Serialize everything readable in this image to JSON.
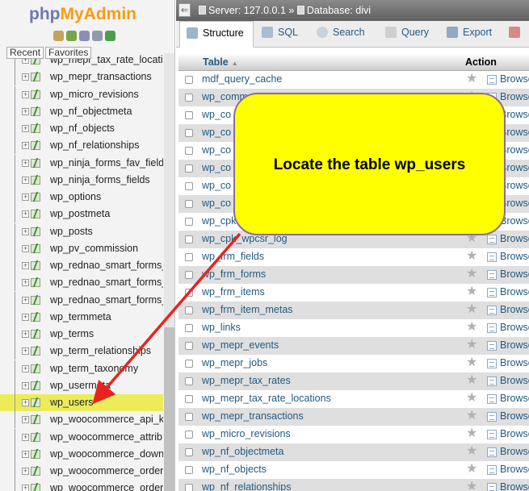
{
  "app": {
    "logo": {
      "php": "php",
      "my": "MyAdmin"
    },
    "logo_icons": [
      "home-icon",
      "exit-icon",
      "docs-icon",
      "settings-icon",
      "reload-icon"
    ]
  },
  "nav": {
    "tabs": [
      "Recent",
      "Favorites"
    ],
    "tree_items": [
      {
        "label": "wp_mepr_tax_rate_locati",
        "highlighted": false
      },
      {
        "label": "wp_mepr_transactions",
        "highlighted": false
      },
      {
        "label": "wp_micro_revisions",
        "highlighted": false
      },
      {
        "label": "wp_nf_objectmeta",
        "highlighted": false
      },
      {
        "label": "wp_nf_objects",
        "highlighted": false
      },
      {
        "label": "wp_nf_relationships",
        "highlighted": false
      },
      {
        "label": "wp_ninja_forms_fav_field",
        "highlighted": false
      },
      {
        "label": "wp_ninja_forms_fields",
        "highlighted": false
      },
      {
        "label": "wp_options",
        "highlighted": false
      },
      {
        "label": "wp_postmeta",
        "highlighted": false
      },
      {
        "label": "wp_posts",
        "highlighted": false
      },
      {
        "label": "wp_pv_commission",
        "highlighted": false
      },
      {
        "label": "wp_rednao_smart_forms_",
        "highlighted": false
      },
      {
        "label": "wp_rednao_smart_forms_",
        "highlighted": false
      },
      {
        "label": "wp_rednao_smart_forms_",
        "highlighted": false
      },
      {
        "label": "wp_termmeta",
        "highlighted": false
      },
      {
        "label": "wp_terms",
        "highlighted": false
      },
      {
        "label": "wp_term_relationships",
        "highlighted": false
      },
      {
        "label": "wp_term_taxonomy",
        "highlighted": false
      },
      {
        "label": "wp_usermeta",
        "highlighted": false
      },
      {
        "label": "wp_users",
        "highlighted": true
      },
      {
        "label": "wp_woocommerce_api_k",
        "highlighted": false
      },
      {
        "label": "wp_woocommerce_attrib",
        "highlighted": false
      },
      {
        "label": "wp_woocommerce_down",
        "highlighted": false
      },
      {
        "label": "wp_woocommerce_order",
        "highlighted": false
      },
      {
        "label": "wp_woocommerce_order",
        "highlighted": false
      }
    ]
  },
  "breadcrumb": {
    "server": "Server: 127.0.0.1",
    "separator": "»",
    "database": "Database: divi"
  },
  "tabs": [
    {
      "label": "Structure",
      "icon": "structure-icon",
      "active": true
    },
    {
      "label": "SQL",
      "icon": "sql-icon",
      "active": false
    },
    {
      "label": "Search",
      "icon": "search-icon",
      "active": false
    },
    {
      "label": "Query",
      "icon": "query-icon",
      "active": false
    },
    {
      "label": "Export",
      "icon": "export-icon",
      "active": false
    },
    {
      "label": "",
      "icon": "import-icon",
      "active": false
    }
  ],
  "table": {
    "headers": {
      "table": "Table",
      "action": "Action",
      "sort_glyph": "▲"
    },
    "browse_label": "Browse",
    "rows": [
      "mdf_query_cache",
      "wp_comm",
      "wp_co",
      "wp_co",
      "wp_co",
      "wp_co",
      "wp_co",
      "wp_co",
      "wp_cpk",
      "wp_cpk_wpcsr_log",
      "wp_frm_fields",
      "wp_frm_forms",
      "wp_frm_items",
      "wp_frm_item_metas",
      "wp_links",
      "wp_mepr_events",
      "wp_mepr_jobs",
      "wp_mepr_tax_rates",
      "wp_mepr_tax_rate_locations",
      "wp_mepr_transactions",
      "wp_micro_revisions",
      "wp_nf_objectmeta",
      "wp_nf_objects",
      "wp_nf_relationships"
    ]
  },
  "annotation": {
    "text": "Locate the table wp_users",
    "fill": "#ffff00",
    "arrow_color": "#e8231f"
  },
  "colors": {
    "link": "#235a81",
    "highlight": "#ecec5a",
    "row_even": "#dfdfdf"
  }
}
